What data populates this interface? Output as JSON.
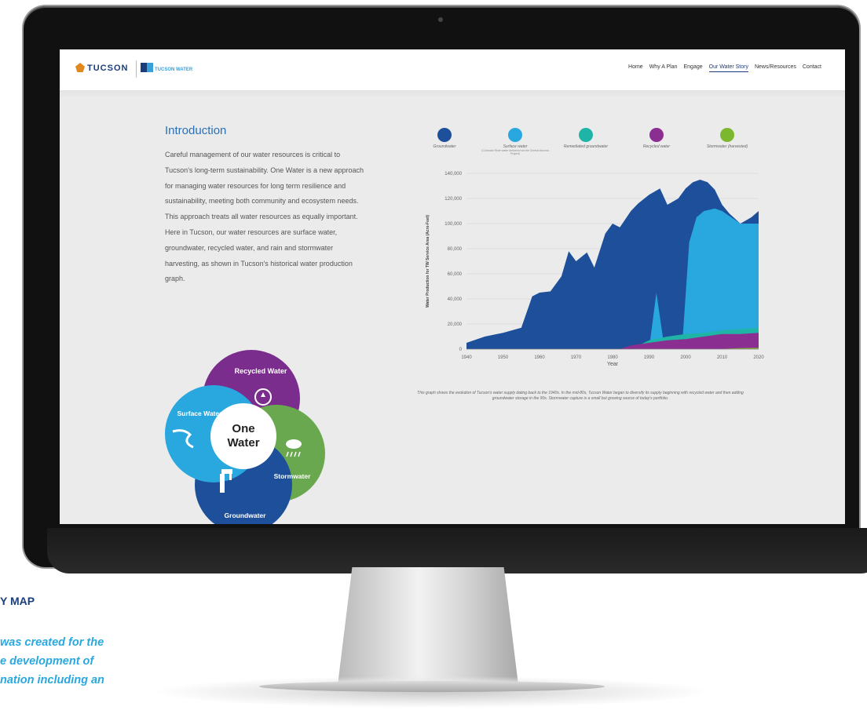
{
  "site": {
    "city_logo_small": "CITY OF",
    "city_logo": "TUCSON",
    "water_logo": "TUCSON WATER"
  },
  "nav": {
    "items": [
      "Home",
      "Why A Plan",
      "Engage",
      "Our Water Story",
      "News/Resources",
      "Contact"
    ],
    "active": "Our Water Story"
  },
  "intro": {
    "title": "Introduction",
    "body": "Careful management of our water resources is critical to Tucson's long-term sustainability. One Water is a new approach for managing water resources for long term resilience and sustainability, meeting both community and ecosystem needs. This approach treats all water resources as equally important. Here in Tucson, our water resources are surface water, groundwater, recycled water, and rain and stormwater harvesting, as shown in Tucson's historical water production graph."
  },
  "venn": {
    "center_line1": "One",
    "center_line2": "Water",
    "recycled": "Recycled Water",
    "surface": "Surface Water",
    "storm": "Stormwater",
    "ground": "Groundwater",
    "colors": {
      "recycled": "#7a2d8c",
      "surface": "#29a8e0",
      "storm": "#6aa84f",
      "ground": "#1e4f9a"
    }
  },
  "legend": [
    {
      "label": "Groundwater",
      "sub": "",
      "color": "#1e4f9a"
    },
    {
      "label": "Surface water",
      "sub": "(Colorado River water delivered via the Central Arizona Project)",
      "color": "#29a8e0"
    },
    {
      "label": "Remediated groundwater",
      "sub": "",
      "color": "#1fb5a6"
    },
    {
      "label": "Recycled water",
      "sub": "",
      "color": "#8b2e92"
    },
    {
      "label": "Stormwater (harvested)",
      "sub": "",
      "color": "#7cb82f"
    }
  ],
  "chart_data": {
    "type": "area",
    "xlabel": "Year",
    "ylabel": "Water Production for TW Service Area (Acre-Feet)",
    "x_ticks": [
      "1940",
      "1950",
      "1960",
      "1970",
      "1980",
      "1990",
      "2000",
      "2010",
      "2020"
    ],
    "y_ticks": [
      "0",
      "20,000",
      "40,000",
      "60,000",
      "80,000",
      "100,000",
      "120,000",
      "140,000"
    ],
    "ylim": [
      0,
      140000
    ],
    "xlim": [
      1940,
      2020
    ],
    "grid": true,
    "series": [
      {
        "name": "Groundwater",
        "color": "#1e4f9a",
        "points": [
          [
            1940,
            5000
          ],
          [
            1945,
            10000
          ],
          [
            1950,
            13000
          ],
          [
            1955,
            17000
          ],
          [
            1958,
            42000
          ],
          [
            1960,
            45000
          ],
          [
            1963,
            46000
          ],
          [
            1966,
            58000
          ],
          [
            1968,
            78000
          ],
          [
            1970,
            70000
          ],
          [
            1973,
            77000
          ],
          [
            1975,
            65000
          ],
          [
            1978,
            92000
          ],
          [
            1980,
            100000
          ],
          [
            1982,
            97000
          ],
          [
            1985,
            110000
          ],
          [
            1987,
            116000
          ],
          [
            1990,
            123000
          ],
          [
            1993,
            128000
          ],
          [
            1995,
            115000
          ],
          [
            1998,
            120000
          ],
          [
            2000,
            128000
          ],
          [
            2002,
            133000
          ],
          [
            2004,
            135000
          ],
          [
            2006,
            133000
          ],
          [
            2008,
            127000
          ],
          [
            2010,
            115000
          ],
          [
            2012,
            108000
          ],
          [
            2015,
            100000
          ],
          [
            2018,
            105000
          ],
          [
            2020,
            110000
          ]
        ]
      },
      {
        "name": "Surface water",
        "color": "#29a8e0",
        "points": [
          [
            1940,
            0
          ],
          [
            1990,
            0
          ],
          [
            1992,
            45000
          ],
          [
            1994,
            5000
          ],
          [
            1999,
            0
          ],
          [
            2001,
            85000
          ],
          [
            2003,
            105000
          ],
          [
            2005,
            110000
          ],
          [
            2008,
            112000
          ],
          [
            2010,
            110000
          ],
          [
            2015,
            100000
          ],
          [
            2020,
            100000
          ]
        ]
      },
      {
        "name": "Remediated groundwater",
        "color": "#1fb5a6",
        "points": [
          [
            1940,
            0
          ],
          [
            1985,
            0
          ],
          [
            1990,
            7000
          ],
          [
            1995,
            10000
          ],
          [
            2000,
            12000
          ],
          [
            2005,
            13000
          ],
          [
            2010,
            15000
          ],
          [
            2015,
            16000
          ],
          [
            2020,
            17000
          ]
        ]
      },
      {
        "name": "Recycled water",
        "color": "#8b2e92",
        "points": [
          [
            1940,
            0
          ],
          [
            1982,
            0
          ],
          [
            1985,
            3000
          ],
          [
            1990,
            5000
          ],
          [
            1995,
            7000
          ],
          [
            2000,
            8000
          ],
          [
            2005,
            10000
          ],
          [
            2010,
            12000
          ],
          [
            2015,
            12000
          ],
          [
            2020,
            13000
          ]
        ]
      },
      {
        "name": "Stormwater (harvested)",
        "color": "#7cb82f",
        "points": [
          [
            1940,
            0
          ],
          [
            2010,
            0
          ],
          [
            2012,
            500
          ],
          [
            2015,
            800
          ],
          [
            2020,
            1000
          ]
        ]
      }
    ]
  },
  "caption": "This graph shows the evolution of Tucson's water supply dating back to the 1940s. In the mid-80s, Tucson Water began to diversify its supply beginning with recycled water and then adding groundwater storage in the 90s. Stormwater capture is a small but growing source of today's portfolio.",
  "page": {
    "heading": "Y MAP",
    "italic_lines": [
      "was created for the",
      "e development of",
      "nation including an"
    ]
  }
}
